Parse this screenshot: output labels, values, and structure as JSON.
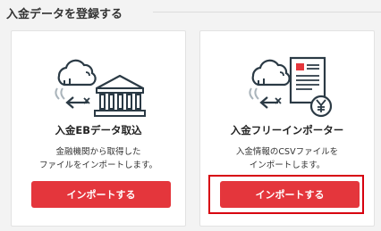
{
  "section": {
    "title": "入金データを登録する"
  },
  "cards": [
    {
      "title": "入金EBデータ取込",
      "desc_line1": "金融機関から取得した",
      "desc_line2": "ファイルをインポートします。",
      "button_label": "インポートする",
      "icon": "cloud-to-bank-icon"
    },
    {
      "title": "入金フリーインポーター",
      "desc_line1": "入金情報のCSVファイルを",
      "desc_line2": "インポートします。",
      "button_label": "インポートする",
      "icon": "cloud-to-document-yen-icon"
    }
  ],
  "colors": {
    "button": "#e4363c",
    "highlight_border": "#d7000f",
    "icon_dark": "#2b3a45",
    "icon_gray": "#aab4bb"
  }
}
